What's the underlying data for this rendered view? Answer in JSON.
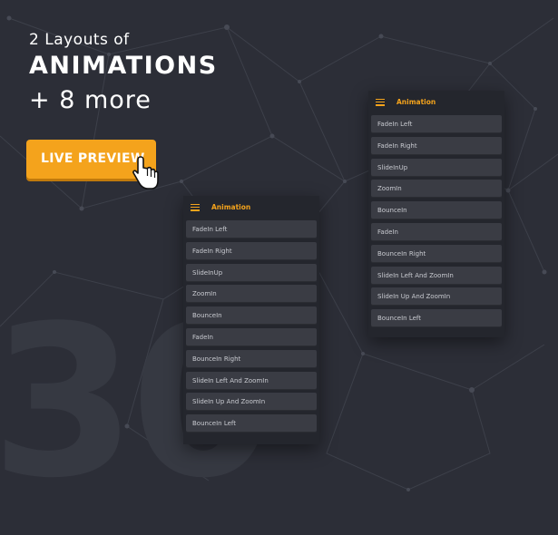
{
  "hero": {
    "subtitle": "2 Layouts of",
    "title": "ANIMATIONS",
    "more": "+ 8 more"
  },
  "live_preview": {
    "label": "LIVE PREVIEW"
  },
  "background_number": "30",
  "colors": {
    "background": "#2c2e37",
    "accent": "#f4a31c",
    "panel": "#24262d",
    "item": "#3a3c44"
  },
  "icons": {
    "menu": "hamburger-menu-icon",
    "cursor": "pointing-hand-cursor-icon"
  },
  "phones": [
    {
      "header_title": "Animation",
      "items": [
        "FadeIn Left",
        "FadeIn Right",
        "SlideInUp",
        "ZoomIn",
        "BounceIn",
        "FadeIn",
        "BounceIn Right",
        "SlideIn Left And ZoomIn",
        "SlideIn Up And ZoomIn",
        "BounceIn Left"
      ]
    },
    {
      "header_title": "Animation",
      "items": [
        "FadeIn Left",
        "FadeIn Right",
        "SlideInUp",
        "ZoomIn",
        "BounceIn",
        "FadeIn",
        "BounceIn Right",
        "SlideIn Left And ZoomIn",
        "SlideIn Up And ZoomIn",
        "BounceIn Left"
      ]
    }
  ]
}
